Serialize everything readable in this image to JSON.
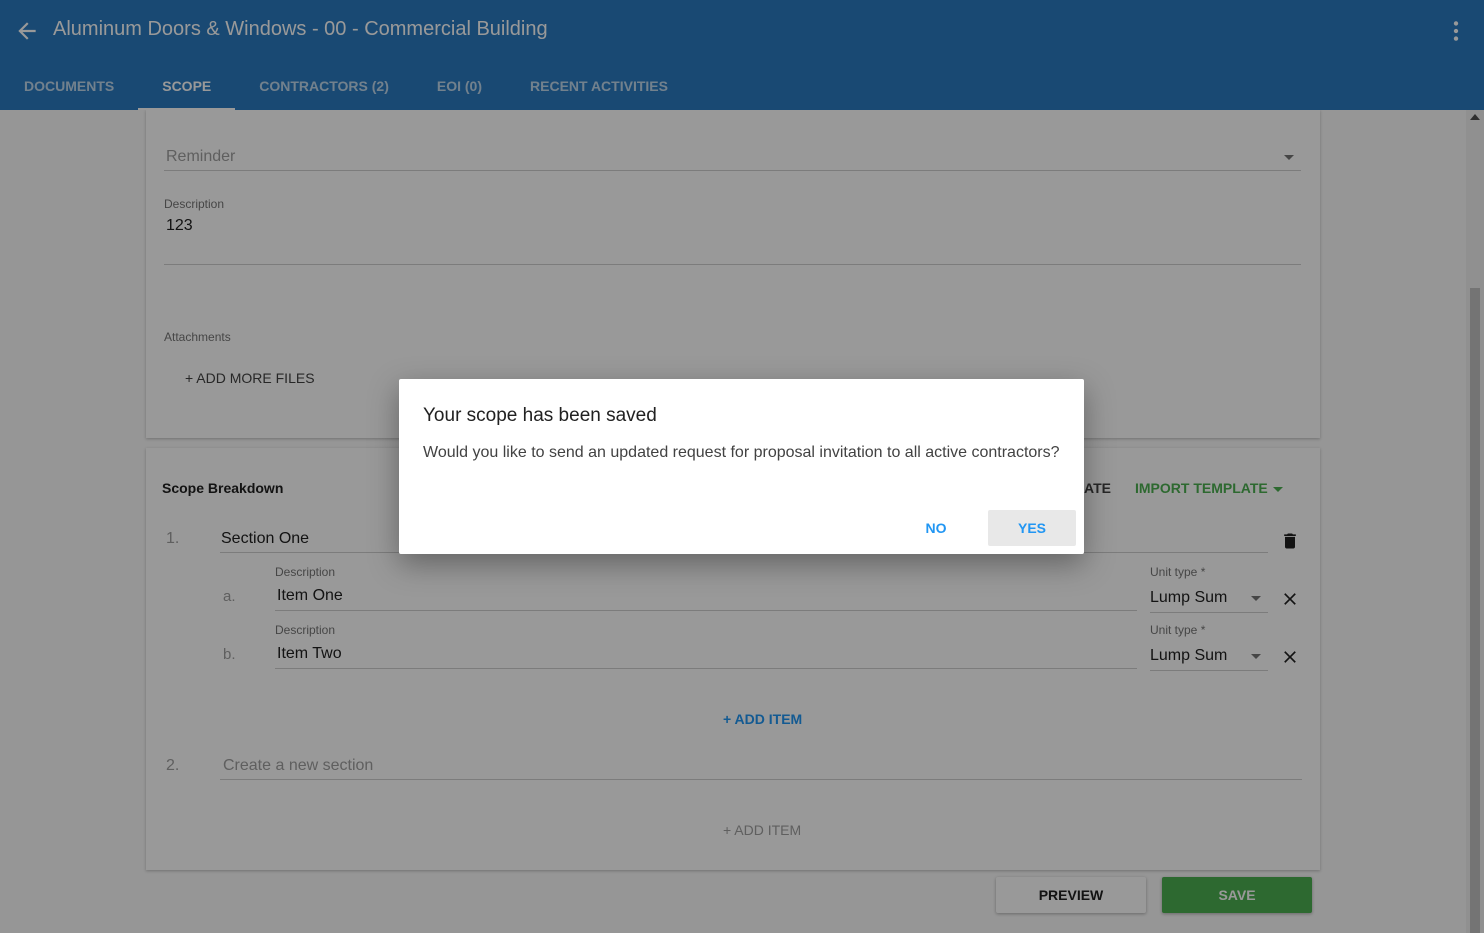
{
  "header": {
    "title": "Aluminum Doors & Windows - 00 - Commercial Building",
    "tabs": [
      {
        "label": "DOCUMENTS"
      },
      {
        "label": "SCOPE"
      },
      {
        "label": "CONTRACTORS (2)"
      },
      {
        "label": "EOI (0)"
      },
      {
        "label": "RECENT ACTIVITIES"
      }
    ]
  },
  "form": {
    "reminder_placeholder": "Reminder",
    "description_label": "Description",
    "description_value": "123",
    "attachments_label": "Attachments",
    "add_files_label": "+ ADD MORE FILES"
  },
  "scope": {
    "heading": "Scope Breakdown",
    "partial_action_label": "ATE",
    "import_template_label": "IMPORT TEMPLATE",
    "sections": [
      {
        "number": "1.",
        "name": "Section One",
        "items": [
          {
            "letter": "a.",
            "description_label": "Description",
            "description": "Item One",
            "unit_label": "Unit type *",
            "unit": "Lump Sum"
          },
          {
            "letter": "b.",
            "description_label": "Description",
            "description": "Item Two",
            "unit_label": "Unit type *",
            "unit": "Lump Sum"
          }
        ],
        "add_item_label": "+ ADD ITEM"
      },
      {
        "number": "2.",
        "placeholder": "Create a new section",
        "add_item_label": "+ ADD ITEM"
      }
    ]
  },
  "actions": {
    "preview_label": "PREVIEW",
    "save_label": "SAVE"
  },
  "dialog": {
    "title": "Your scope has been saved",
    "body": "Would you like to send an updated request for proposal invitation to all active contractors?",
    "no_label": "NO",
    "yes_label": "YES"
  },
  "colors": {
    "appbar": "#2b7bc0",
    "accent_blue": "#2196f3",
    "accent_green": "#4caf50"
  }
}
